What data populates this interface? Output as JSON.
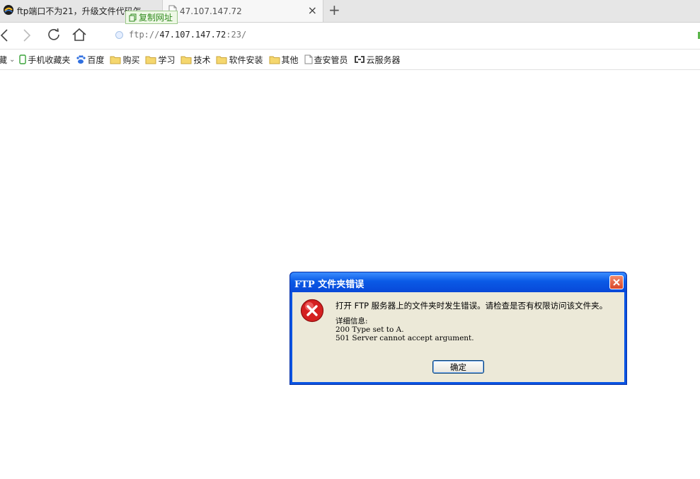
{
  "tabs": [
    {
      "title": "ftp端口不为21，升级文件代码怎"
    },
    {
      "title": "47.107.147.72",
      "close": "×"
    }
  ],
  "new_tab": "+",
  "copy_tooltip": "复制网址",
  "address": {
    "scheme": "ftp://",
    "host": "47.107.147.72",
    "port": ":23/"
  },
  "bookmarks": {
    "first": "藏",
    "first_caret": "⌄",
    "items": [
      {
        "label": "手机收藏夹",
        "icon": "phone-icon"
      },
      {
        "label": "百度",
        "icon": "baidu-paw-icon"
      },
      {
        "label": "购买",
        "icon": "folder-icon"
      },
      {
        "label": "学习",
        "icon": "folder-icon"
      },
      {
        "label": "技术",
        "icon": "folder-icon"
      },
      {
        "label": "软件安装",
        "icon": "folder-icon"
      },
      {
        "label": "其他",
        "icon": "folder-icon"
      },
      {
        "label": "查安管员",
        "icon": "page-icon"
      },
      {
        "label": "云服务器",
        "icon": "cloud-server-icon"
      }
    ]
  },
  "dialog": {
    "title": "FTP 文件夹错误",
    "message": "打开 FTP 服务器上的文件夹时发生错误。请检查是否有权限访问该文件夹。",
    "details_label": "详细信息:",
    "details": [
      "200 Type set to A.",
      "501 Server cannot accept argument."
    ],
    "ok_label": "确定"
  },
  "colors": {
    "dialog_title": "#0a54e2",
    "dialog_body": "#ece9d8",
    "error_red": "#d42020",
    "copy_green": "#2f8a1d"
  }
}
